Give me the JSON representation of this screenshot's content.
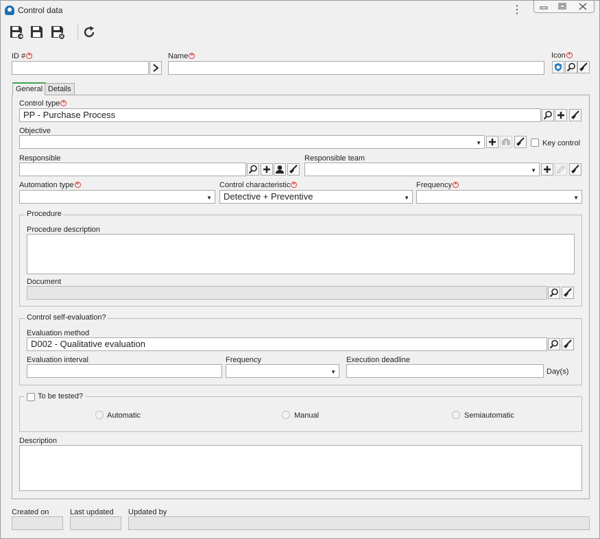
{
  "window": {
    "title": "Control data"
  },
  "header": {
    "id_label": "ID #",
    "id_value": "",
    "name_label": "Name",
    "name_value": "",
    "icon_label": "Icon"
  },
  "tabs": [
    {
      "label": "General",
      "active": true
    },
    {
      "label": "Details",
      "active": false
    }
  ],
  "general": {
    "control_type": {
      "label": "Control type",
      "value": "PP - Purchase Process"
    },
    "objective": {
      "label": "Objective",
      "value": "",
      "key_control_label": "Key control",
      "key_control_checked": false
    },
    "responsible": {
      "label": "Responsible",
      "value": ""
    },
    "responsible_team": {
      "label": "Responsible team",
      "value": ""
    },
    "automation_type": {
      "label": "Automation type",
      "value": ""
    },
    "control_characteristic": {
      "label": "Control characteristic",
      "value": "Detective + Preventive"
    },
    "frequency": {
      "label": "Frequency",
      "value": ""
    },
    "procedure": {
      "legend": "Procedure",
      "description_label": "Procedure description",
      "description_value": "",
      "document_label": "Document",
      "document_value": ""
    },
    "self_evaluation": {
      "legend": "Control self-evaluation?",
      "method_label": "Evaluation method",
      "method_value": "D002 - Qualitative evaluation",
      "interval_label": "Evaluation interval",
      "interval_value": "",
      "frequency_label": "Frequency",
      "frequency_value": "",
      "deadline_label": "Execution deadline",
      "deadline_value": "",
      "deadline_unit": "Day(s)"
    },
    "testing": {
      "legend": "To be tested?",
      "checked": false,
      "options": [
        "Automatic",
        "Manual",
        "Semiautomatic"
      ]
    },
    "description": {
      "label": "Description",
      "value": ""
    }
  },
  "footer": {
    "created_on_label": "Created on",
    "created_on_value": "",
    "last_updated_label": "Last updated",
    "last_updated_value": "",
    "updated_by_label": "Updated by",
    "updated_by_value": ""
  },
  "colors": {
    "required": "#d9302c",
    "accent_tab": "#3fa34d",
    "app_icon": "#1f6fb2"
  }
}
